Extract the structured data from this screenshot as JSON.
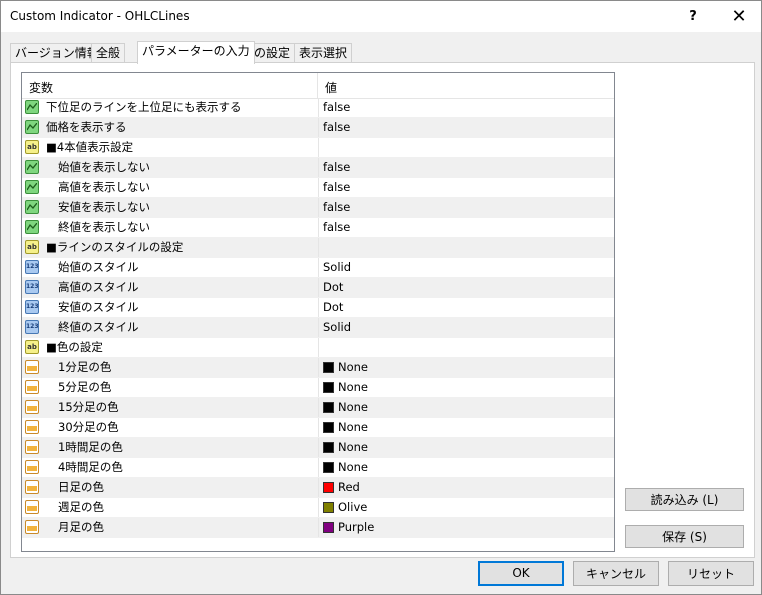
{
  "window": {
    "title": "Custom Indicator - OHLCLines",
    "help_label": "?",
    "close_label": "✕"
  },
  "tabs": [
    {
      "label": "バージョン情報",
      "active": false
    },
    {
      "label": "全般",
      "active": false
    },
    {
      "label": "パラメーターの入力",
      "active": true
    },
    {
      "label": "色の設定",
      "active": false
    },
    {
      "label": "表示選択",
      "active": false
    }
  ],
  "grid": {
    "header": {
      "variable": "変数",
      "value": "値"
    },
    "rows": [
      {
        "name": "下位足のラインを上位足にも表示する",
        "value": "false",
        "icon": "bool-icon",
        "indent": false
      },
      {
        "name": "価格を表示する",
        "value": "false",
        "icon": "bool-icon",
        "indent": false
      },
      {
        "name": "■4本値表示設定",
        "value": "",
        "icon": "string-icon",
        "indent": false
      },
      {
        "name": "始値を表示しない",
        "value": "false",
        "icon": "bool-icon",
        "indent": true
      },
      {
        "name": "高値を表示しない",
        "value": "false",
        "icon": "bool-icon",
        "indent": true
      },
      {
        "name": "安値を表示しない",
        "value": "false",
        "icon": "bool-icon",
        "indent": true
      },
      {
        "name": "終値を表示しない",
        "value": "false",
        "icon": "bool-icon",
        "indent": true
      },
      {
        "name": "■ラインのスタイルの設定",
        "value": "",
        "icon": "string-icon",
        "indent": false
      },
      {
        "name": "始値のスタイル",
        "value": "Solid",
        "icon": "number-icon",
        "indent": true
      },
      {
        "name": "高値のスタイル",
        "value": "Dot",
        "icon": "number-icon",
        "indent": true
      },
      {
        "name": "安値のスタイル",
        "value": "Dot",
        "icon": "number-icon",
        "indent": true
      },
      {
        "name": "終値のスタイル",
        "value": "Solid",
        "icon": "number-icon",
        "indent": true
      },
      {
        "name": "■色の設定",
        "value": "",
        "icon": "string-icon",
        "indent": false
      },
      {
        "name": "1分足の色",
        "value": "None",
        "icon": "color-icon",
        "indent": true,
        "swatch": "#000000"
      },
      {
        "name": "5分足の色",
        "value": "None",
        "icon": "color-icon",
        "indent": true,
        "swatch": "#000000"
      },
      {
        "name": "15分足の色",
        "value": "None",
        "icon": "color-icon",
        "indent": true,
        "swatch": "#000000"
      },
      {
        "name": "30分足の色",
        "value": "None",
        "icon": "color-icon",
        "indent": true,
        "swatch": "#000000"
      },
      {
        "name": "1時間足の色",
        "value": "None",
        "icon": "color-icon",
        "indent": true,
        "swatch": "#000000"
      },
      {
        "name": "4時間足の色",
        "value": "None",
        "icon": "color-icon",
        "indent": true,
        "swatch": "#000000"
      },
      {
        "name": "日足の色",
        "value": "Red",
        "icon": "color-icon",
        "indent": true,
        "swatch": "#ff0000"
      },
      {
        "name": "週足の色",
        "value": "Olive",
        "icon": "color-icon",
        "indent": true,
        "swatch": "#808000"
      },
      {
        "name": "月足の色",
        "value": "Purple",
        "icon": "color-icon",
        "indent": true,
        "swatch": "#800080"
      }
    ]
  },
  "side_buttons": {
    "load": "読み込み (L)",
    "save": "保存 (S)"
  },
  "footer": {
    "ok": "OK",
    "cancel": "キャンセル",
    "reset": "リセット"
  },
  "colors": {
    "accent": "#0078d7"
  }
}
